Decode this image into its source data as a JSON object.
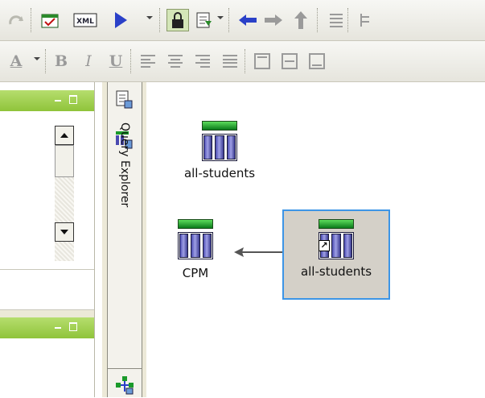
{
  "toolbar_top": {
    "buttons": [
      {
        "name": "redo-icon"
      },
      {
        "name": "calendar-icon"
      },
      {
        "name": "xml-icon",
        "label": "XML"
      },
      {
        "name": "play-icon"
      },
      {
        "name": "lock-icon"
      },
      {
        "name": "export-icon"
      },
      {
        "name": "back-arrow-icon"
      },
      {
        "name": "forward-arrow-icon"
      },
      {
        "name": "up-arrow-icon"
      },
      {
        "name": "list-icon"
      }
    ]
  },
  "toolbar_format": {
    "font_color_label": "A",
    "bold_label": "B",
    "italic_label": "I",
    "underline_label": "U"
  },
  "left_pane": {
    "scrollbar": {
      "up": "up",
      "down": "down"
    }
  },
  "explorer_strip": {
    "label": "Query Explorer"
  },
  "canvas": {
    "nodes": [
      {
        "id": "node-all-students-top",
        "label": "all-students",
        "selected": false
      },
      {
        "id": "node-cpm",
        "label": "CPM",
        "selected": false
      },
      {
        "id": "node-all-students-shortcut",
        "label": "all-students",
        "selected": true,
        "shortcut": true
      }
    ]
  },
  "colors": {
    "pane_title": "#9ccc4c",
    "selection_border": "#3d95e6",
    "table_header": "#1a9a2a",
    "table_column": "#5a5ac0"
  }
}
